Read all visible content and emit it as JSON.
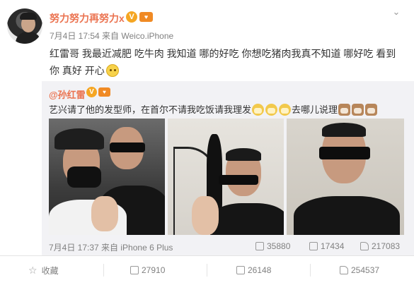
{
  "post": {
    "username": "努力努力再努力x",
    "meta": "7月4日 17:54 来自 Weico.iPhone",
    "text": "红雷哥 我最近减肥 吃牛肉 我知道 哪的好吃 你想吃猪肉我真不知道  哪好吃 看到你 真好 开心",
    "verified_mark": "V"
  },
  "repost": {
    "username": "@孙红雷",
    "text_before": "艺兴请了他的发型师，在首尔不请我吃饭请我理发",
    "text_after": "去哪儿说理",
    "time": "7月4日 17:37 来自 iPhone 6 Plus",
    "stats": {
      "reposts": "35880",
      "comments": "17434",
      "likes": "217083"
    }
  },
  "actions": {
    "favorite": "收藏",
    "repost": "27910",
    "comment": "26148",
    "like": "254537"
  },
  "icons": {
    "avatar": "user-avatar",
    "verified": "verified-badge-icon",
    "vip": "vip-icon",
    "more": "chevron-down-icon",
    "favorite": "star-icon",
    "repost": "repost-icon",
    "comment": "comment-icon",
    "like": "thumbs-up-icon"
  },
  "colors": {
    "username": "#eb7350",
    "meta": "#808080",
    "repost_bg": "#f2f2f5"
  }
}
